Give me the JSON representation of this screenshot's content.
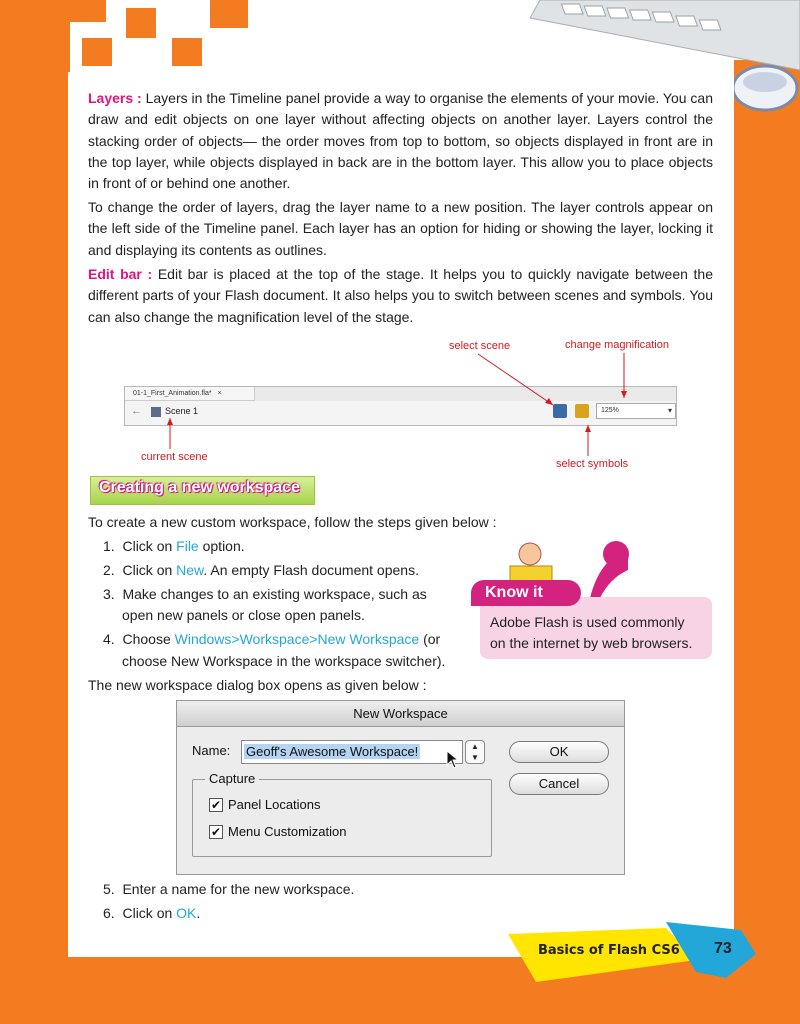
{
  "body": {
    "p1_kw": "Layers :",
    "p1": "Layers in the Timeline panel provide a way to organise the elements of your movie. You can draw and edit objects on one layer without affecting objects on another layer. Layers control the stacking order of objects— the order moves from top to bottom, so objects displayed in front are in the top layer, while objects displayed in back are in the bottom layer. This allow you to place objects in front of or behind one another.",
    "p2": "To change the order of layers, drag the layer name to a new position. The layer controls appear on the left side of the Timeline panel. Each layer has an option for hiding or showing the layer, locking it and displaying its contents as outlines.",
    "p3_kw": "Edit bar :",
    "p3": "Edit bar is placed at the top of the stage. It helps you to quickly navigate between the different parts of your Flash document. It also helps you to switch between scenes and symbols. You can also change the magnification level of the stage."
  },
  "editbar": {
    "tab": "01-1_First_Animation.fla*",
    "tab_close": "×",
    "back": "←",
    "scene": "Scene 1",
    "zoom": "125%",
    "ann_select_scene": "select scene",
    "ann_change_mag": "change magnification",
    "ann_current_scene": "current scene",
    "ann_select_symbols": "select symbols"
  },
  "section": {
    "title": "Creating a new workspace",
    "intro": "To create a new custom workspace, follow the steps given below :",
    "steps": [
      {
        "n": "1.",
        "a": "Click on ",
        "b": "File",
        "c": " option."
      },
      {
        "n": "2.",
        "a": "Click on ",
        "b": "New",
        "c": ". An empty Flash document opens."
      },
      {
        "n": "3.",
        "a": "Make changes to an existing workspace, such as",
        "b": "",
        "c": ""
      },
      {
        "n": "",
        "a": "open new panels or close open panels.",
        "b": "",
        "c": ""
      },
      {
        "n": "4.",
        "a": "Choose ",
        "b": "Windows>Workspace>New Workspace",
        "c": " (or"
      },
      {
        "n": "",
        "a": "choose New Workspace in the workspace switcher).",
        "b": "",
        "c": ""
      }
    ],
    "after": "The new workspace dialog box opens as given below :",
    "steps2": [
      {
        "n": "5.",
        "a": "Enter a name for the new workspace.",
        "b": "",
        "c": ""
      },
      {
        "n": "6.",
        "a": "Click on ",
        "b": "OK",
        "c": "."
      }
    ]
  },
  "knowit": {
    "label": "Know it",
    "line1": "Adobe Flash is used commonly",
    "line2": "on the internet by web browsers."
  },
  "dialog": {
    "title": "New Workspace",
    "name_label": "Name:",
    "name_value": "Geoff's Awesome Workspace!",
    "ok": "OK",
    "cancel": "Cancel",
    "capture": "Capture",
    "check1": "Panel Locations",
    "check2": "Menu Customization",
    "checkmark": "✔"
  },
  "footer": {
    "book": "Basics of Flash CS6",
    "page": "73"
  },
  "colors": {
    "orange": "#f47c20",
    "magenta": "#e0147d",
    "cyan": "#23a7d9",
    "yellow": "#ffe500"
  }
}
